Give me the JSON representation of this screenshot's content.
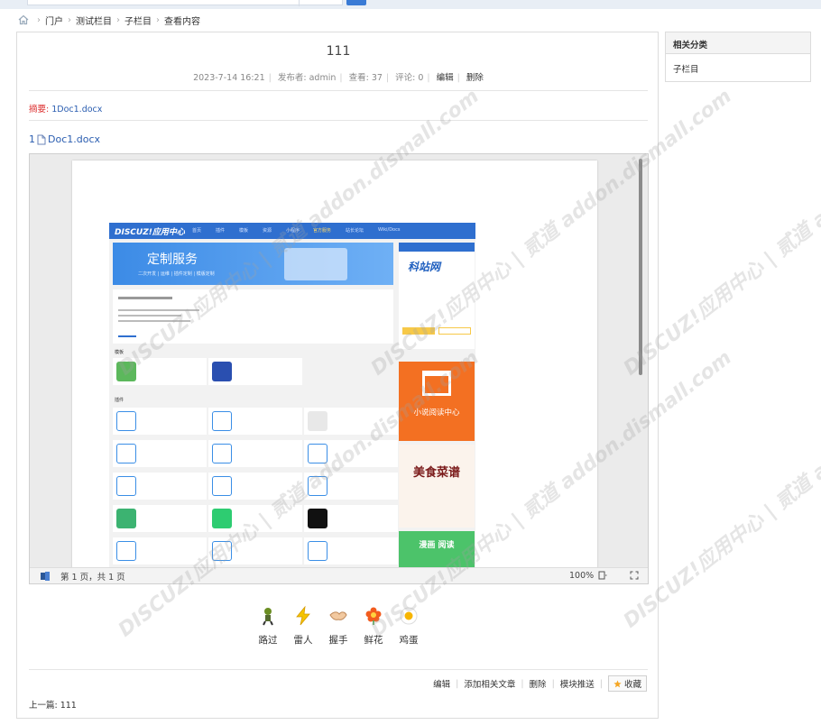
{
  "breadcrumb": [
    "门户",
    "测试栏目",
    "子栏目",
    "查看内容"
  ],
  "article": {
    "title": "111",
    "date": "2023-7-14 16:21",
    "author": "发布者: admin",
    "views": "查看: 37",
    "comments": "评论: 0",
    "edit": "编辑",
    "delete": "删除",
    "summary_label": "摘要:",
    "summary_text": "1Doc1.docx",
    "attach_prefix": "1",
    "attach_name": "Doc1.docx"
  },
  "viewer": {
    "page_info": "第 1 页，共 1 页",
    "zoom": "100%",
    "embedded": {
      "logo": "DISCUZ!应用中心",
      "nav": [
        "首页",
        "插件",
        "模板",
        "资源",
        "小程序",
        "官方服务",
        "站长论坛",
        "Wiki/Docs"
      ],
      "banner_title": "定制服务",
      "banner_sub": "二次开发 | 运维 | 插件定制 | 模版定制",
      "section_templates": "模板",
      "section_plugins": "插件",
      "side_brand": "科站网",
      "side_novel": "小说阅读中心",
      "side_food": "美食菜谱",
      "side_comic": "漫画 阅读"
    }
  },
  "reactions": [
    {
      "label": "路过"
    },
    {
      "label": "雷人"
    },
    {
      "label": "握手"
    },
    {
      "label": "鲜花"
    },
    {
      "label": "鸡蛋"
    }
  ],
  "actions": {
    "edit": "编辑",
    "add_related": "添加相关文章",
    "delete": "删除",
    "push": "模块推送",
    "favorite": "收藏"
  },
  "prev": "上一篇: 111",
  "sidebar": {
    "title": "相关分类",
    "link": "子栏目"
  },
  "watermark": "DISCUZ!应用中心 | 贰道 addon.dismall.com",
  "colors": {
    "link": "#2a5db0",
    "summary_label": "#dd3333",
    "nav_blue": "#2f6fcf"
  }
}
